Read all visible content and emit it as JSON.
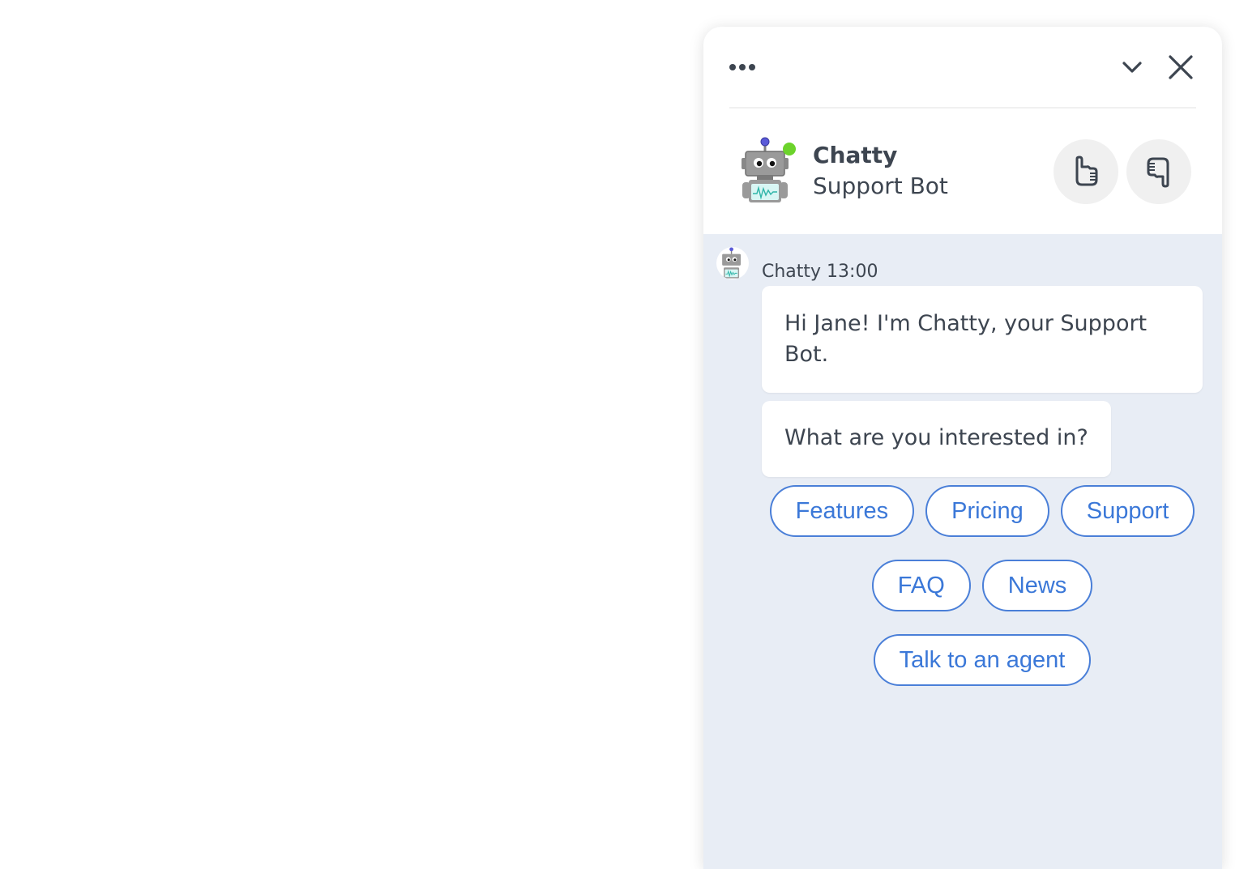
{
  "widget": {
    "toolbar": {
      "more_icon": "more-horizontal-icon",
      "collapse_icon": "chevron-down-icon",
      "close_icon": "close-icon"
    },
    "agent": {
      "name": "Chatty",
      "role": "Support Bot",
      "avatar_icon": "robot-avatar-icon",
      "status": "online",
      "status_color": "#6cd32b"
    },
    "rating": {
      "thumbs_up_icon": "thumbs-up-icon",
      "thumbs_down_icon": "thumbs-down-icon"
    }
  },
  "conversation": {
    "sender": "Chatty",
    "time": "13:00",
    "meta": "Chatty 13:00",
    "messages": [
      {
        "text": "Hi Jane! I'm Chatty, your Support Bot."
      },
      {
        "text": "What are you interested in?"
      }
    ],
    "quick_replies": [
      {
        "label": "Features"
      },
      {
        "label": "Pricing"
      },
      {
        "label": "Support"
      },
      {
        "label": "FAQ"
      },
      {
        "label": "News"
      },
      {
        "label": "Talk to an agent"
      }
    ]
  },
  "colors": {
    "accent": "#3b78d8",
    "chat_background": "#e8edf5",
    "text": "#3d4550"
  }
}
